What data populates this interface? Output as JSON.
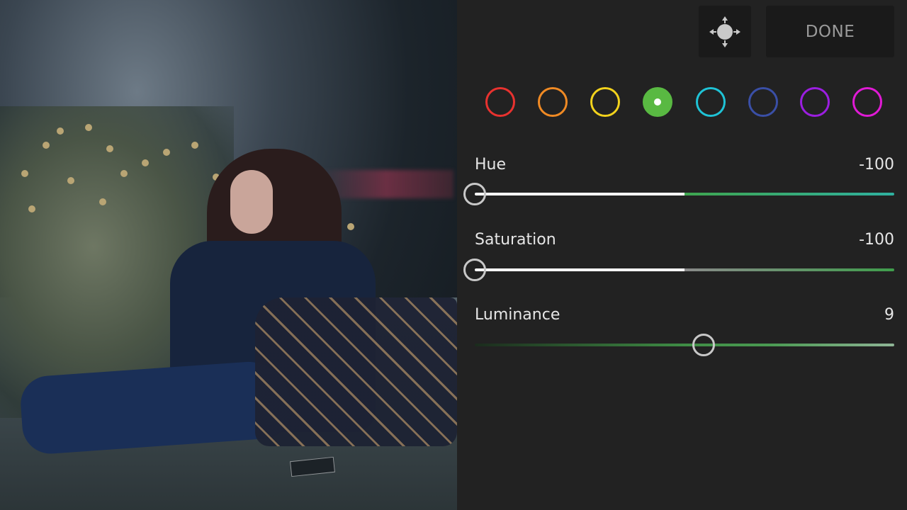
{
  "photo": {
    "description_icon": "photo-preview"
  },
  "toolbar": {
    "move_icon": "move-arrows-icon",
    "done_label": "DONE"
  },
  "color_mix": {
    "selected": "green",
    "swatches": [
      {
        "name": "red",
        "color": "#e8322f"
      },
      {
        "name": "orange",
        "color": "#f08a24"
      },
      {
        "name": "yellow",
        "color": "#f2d21c"
      },
      {
        "name": "green",
        "color": "#59b942"
      },
      {
        "name": "aqua",
        "color": "#1fc3d6"
      },
      {
        "name": "blue",
        "color": "#3a4fa6"
      },
      {
        "name": "purple",
        "color": "#9b1ee0"
      },
      {
        "name": "magenta",
        "color": "#e01ad5"
      }
    ]
  },
  "sliders": {
    "hue": {
      "label": "Hue",
      "value": "-100",
      "min": -100,
      "max": 100,
      "level": -100
    },
    "saturation": {
      "label": "Saturation",
      "value": "-100",
      "min": -100,
      "max": 100,
      "level": -100
    },
    "luminance": {
      "label": "Luminance",
      "value": "9",
      "min": -100,
      "max": 100,
      "level": 9
    }
  }
}
